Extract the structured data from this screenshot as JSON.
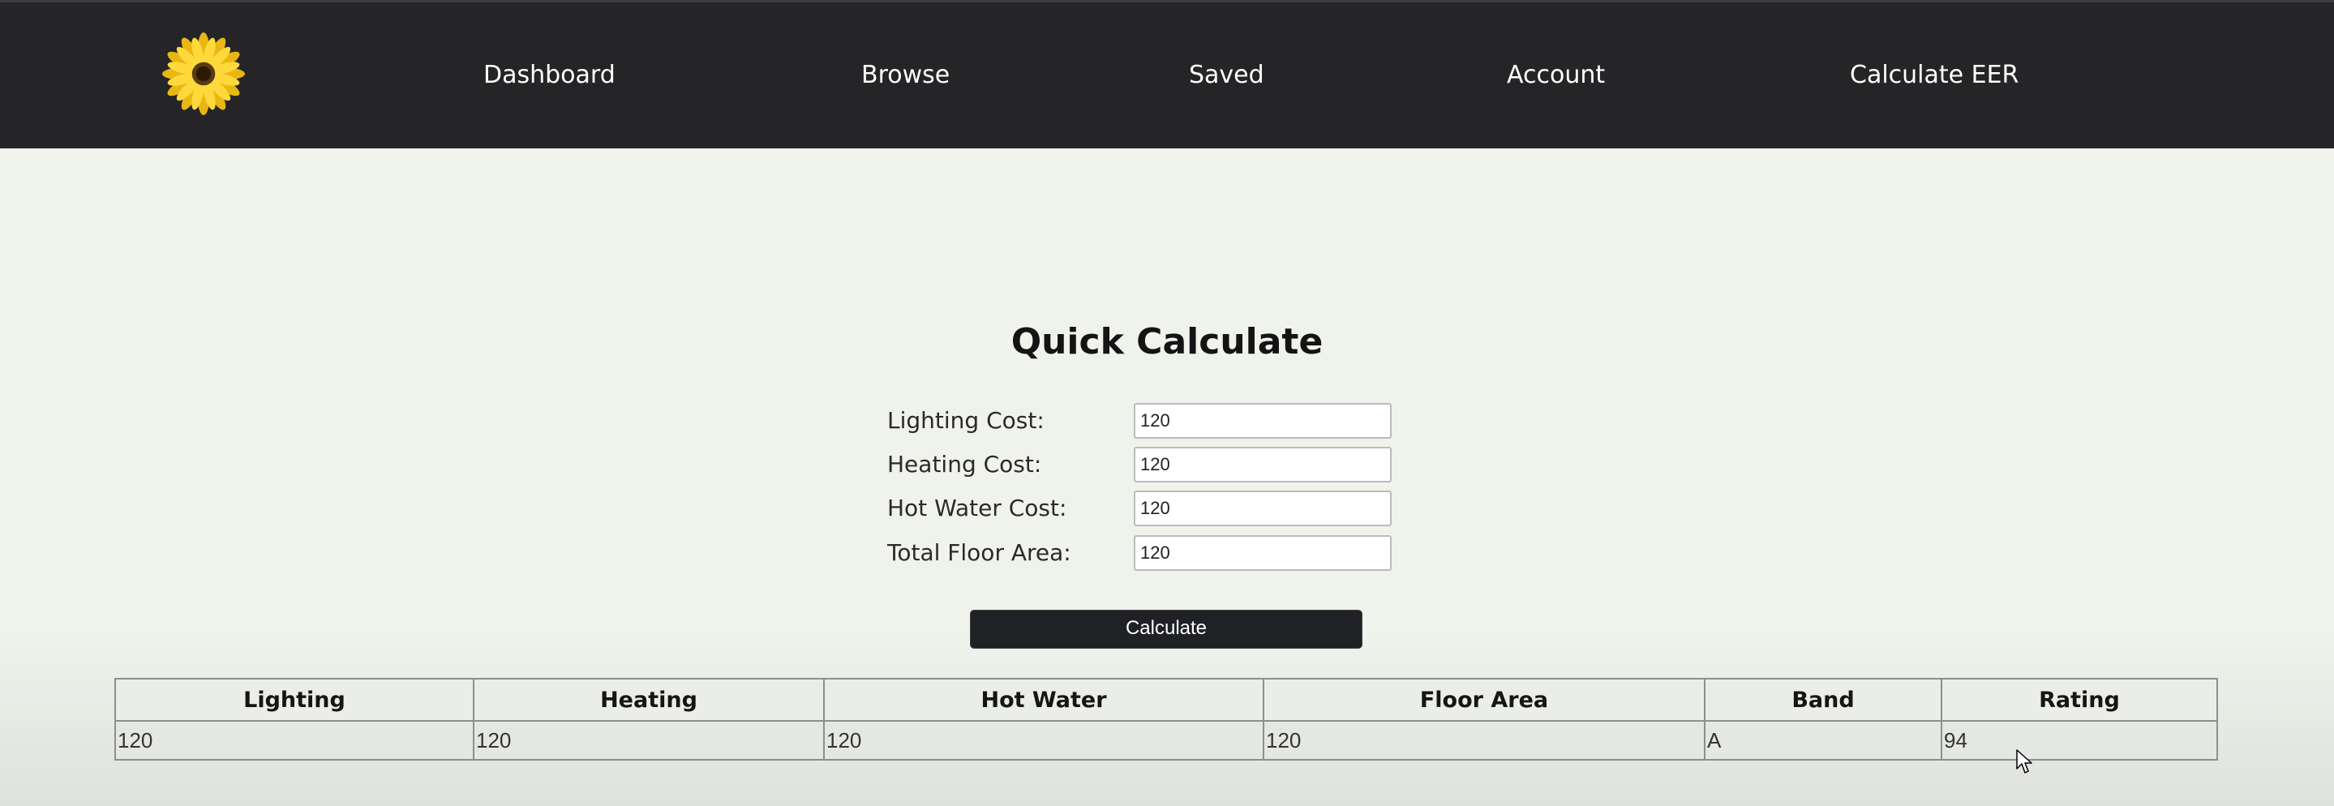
{
  "nav": {
    "items": [
      "Dashboard",
      "Browse",
      "Saved",
      "Account",
      "Calculate EER"
    ]
  },
  "page": {
    "title": "Quick Calculate"
  },
  "form": {
    "fields": [
      {
        "label": "Lighting Cost:",
        "value": "120"
      },
      {
        "label": "Heating Cost:",
        "value": "120"
      },
      {
        "label": "Hot Water Cost:",
        "value": "120"
      },
      {
        "label": "Total Floor Area:",
        "value": "120"
      }
    ],
    "button_label": "Calculate"
  },
  "results": {
    "headers": [
      "Lighting",
      "Heating",
      "Hot Water",
      "Floor Area",
      "Band",
      "Rating"
    ],
    "rows": [
      [
        "120",
        "120",
        "120",
        "120",
        "A",
        "94"
      ]
    ]
  },
  "colors": {
    "navbar": "#252527",
    "background": "#f0f2ec",
    "button": "#202124",
    "logo_petal": "#f5c518"
  },
  "icons": {
    "logo": "sunflower-logo-icon",
    "cursor": "mouse-pointer-icon"
  }
}
